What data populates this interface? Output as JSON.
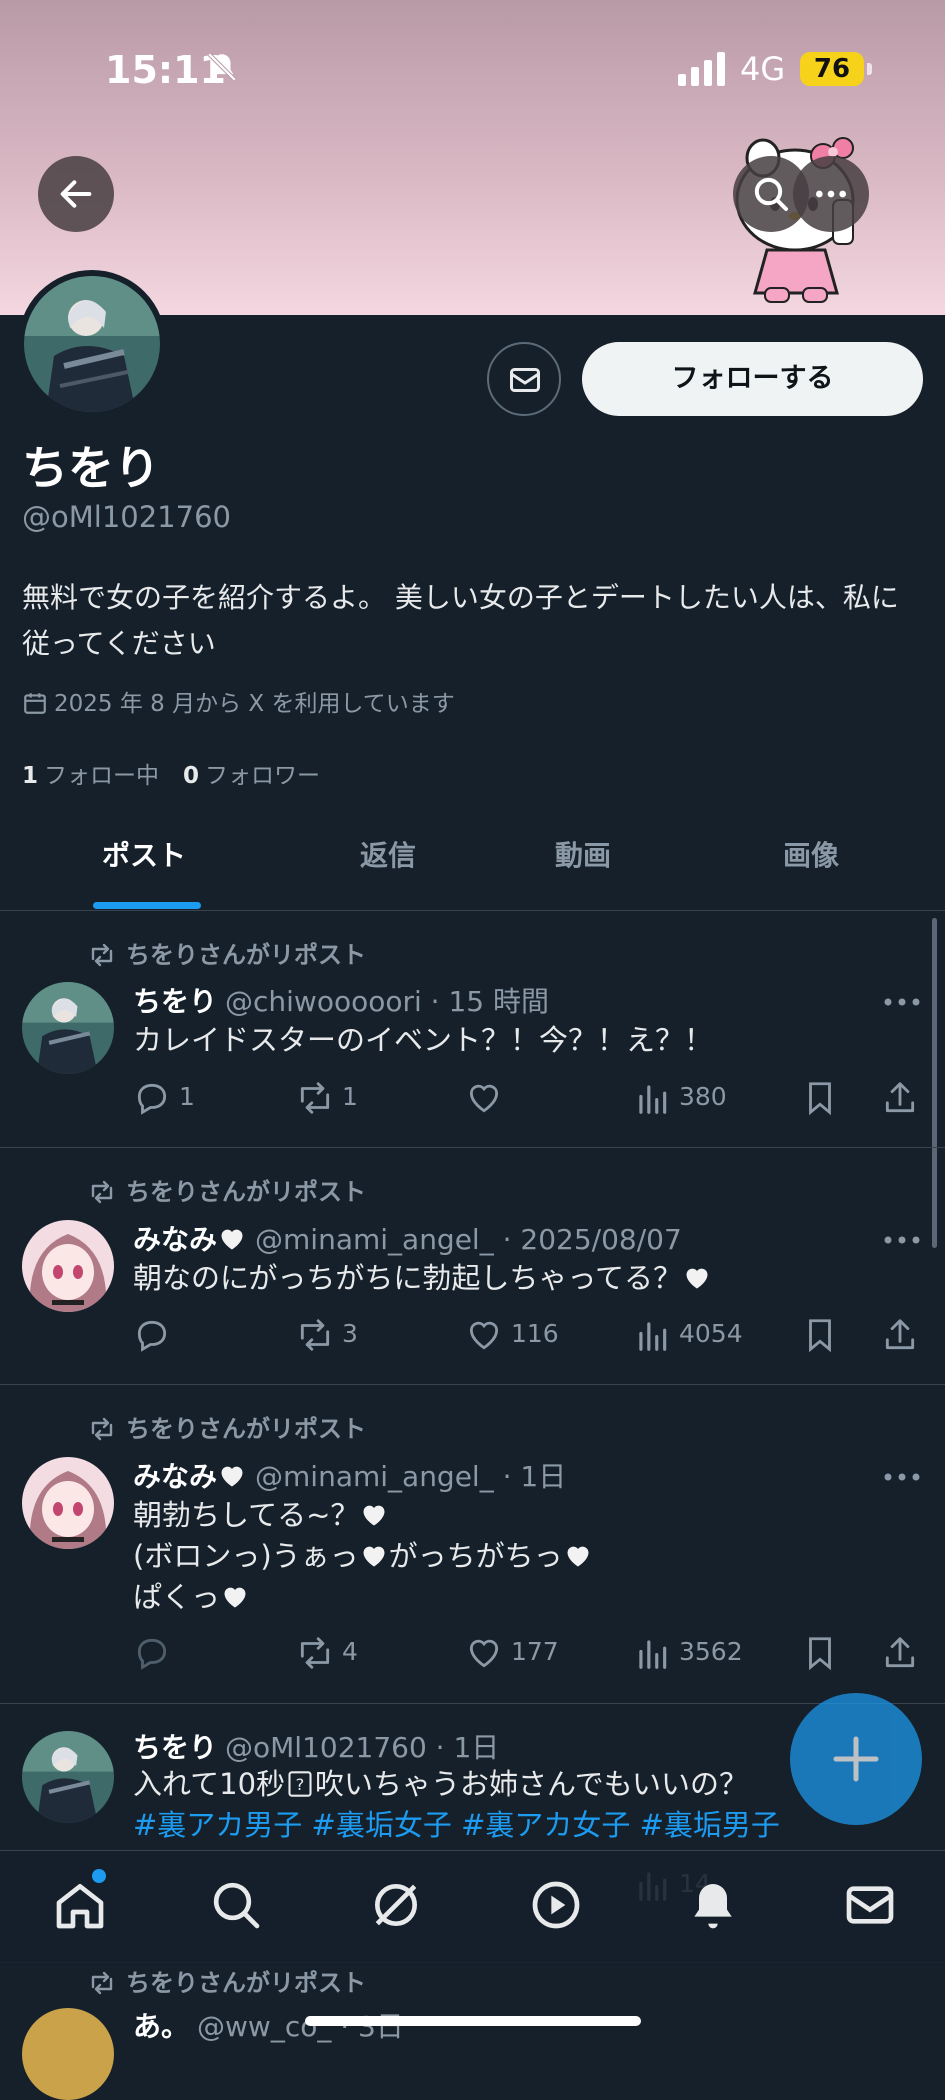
{
  "status_bar": {
    "time": "15:11",
    "network": "4G",
    "battery": "76"
  },
  "profile": {
    "name": "ちをり",
    "handle": "@oMl1021760",
    "bio": "無料で女の子を紹介するよ。 美しい女の子とデートしたい人は、私に従ってください",
    "joined": "2025 年 8 月から X を利用しています",
    "following_count": "1",
    "following_label": "フォロー中",
    "followers_count": "0",
    "followers_label": "フォロワー",
    "follow_button": "フォローする"
  },
  "tabs": [
    "ポスト",
    "返信",
    "動画",
    "画像"
  ],
  "posts": [
    {
      "repost_label": "ちをりさんがリポスト",
      "name": "ちをり",
      "meta": "@chiwooooori · 15 時間",
      "lines": [
        "カレイドスターのイベント？！今？！え？！"
      ],
      "replies": "1",
      "reposts": "1",
      "likes": "",
      "views": "380"
    },
    {
      "repost_label": "ちをりさんがリポスト",
      "name": "みなみ",
      "meta": "@minami_angel_ · 2025/08/07",
      "lines": [
        "朝なのにがっちがちに勃起しちゃってる？"
      ],
      "replies": "",
      "reposts": "3",
      "likes": "116",
      "views": "4054"
    },
    {
      "repost_label": "ちをりさんがリポスト",
      "name": "みなみ",
      "meta": "@minami_angel_ · 1日",
      "lines": [
        "朝勃ちしてる~？",
        "(ボロンっ)うぁっ",
        "がっちがちっ",
        "ぱくっ"
      ],
      "replies": "",
      "reposts": "4",
      "likes": "177",
      "views": "3562"
    },
    {
      "name": "ちをり",
      "meta": "@oMl1021760 · 1日",
      "lines": [
        "入れて10秒",
        "吹いちゃうお姉さんでもいいの？"
      ],
      "hashtags": [
        "#裏アカ男子",
        "#裏垢女子",
        "#裏アカ女子",
        "#裏垢男子"
      ],
      "views": "14"
    },
    {
      "repost_label": "ちをりさんがリポスト",
      "name": "あ。",
      "meta": "@ww_co_ · 3日"
    }
  ],
  "colors": {
    "background": "#15202b",
    "accent": "#1d9bf0",
    "text": "#e7e9ea",
    "muted": "#8b98a5"
  }
}
